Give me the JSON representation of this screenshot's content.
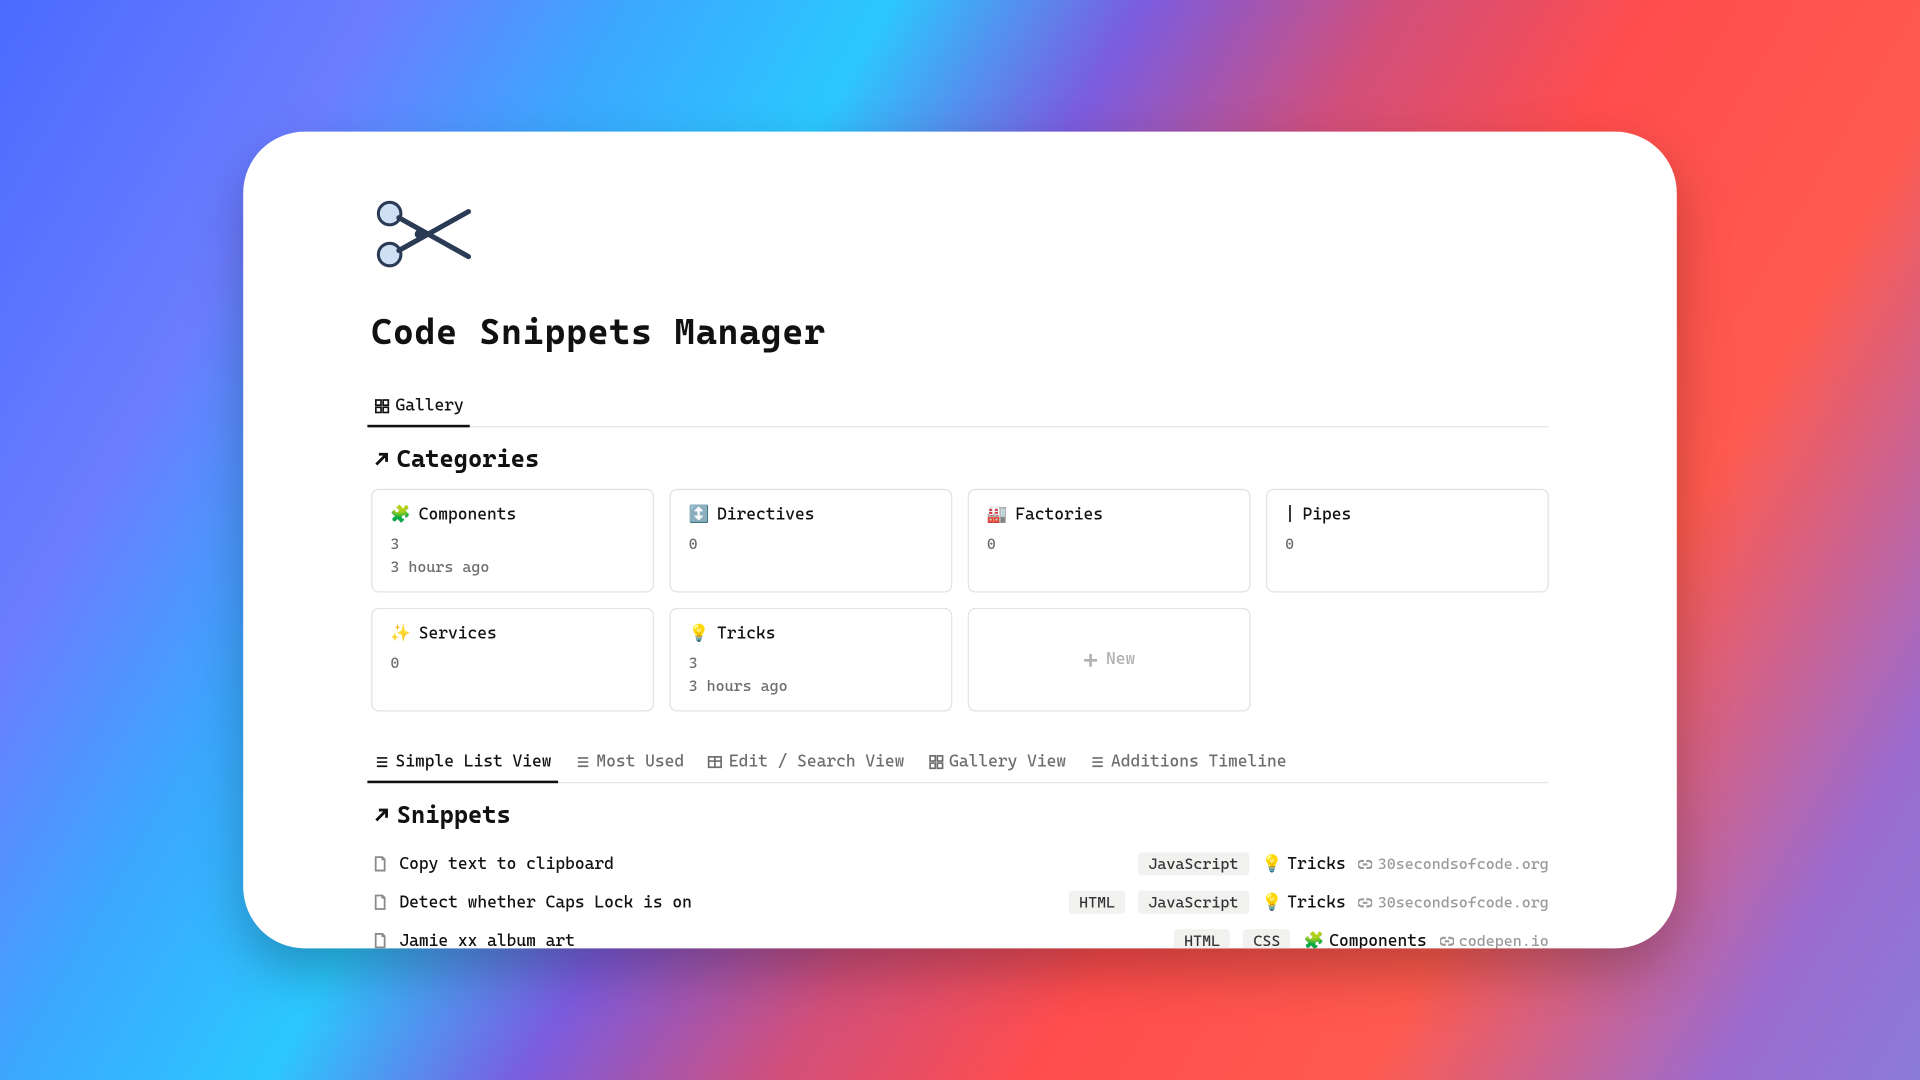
{
  "page": {
    "title": "Code Snippets Manager"
  },
  "views_categories": {
    "tabs": [
      {
        "label": "Gallery",
        "active": true,
        "icon": "gallery"
      }
    ]
  },
  "section_categories": {
    "title": "Categories",
    "items": [
      {
        "emoji": "🧩",
        "name": "Components",
        "count": "3",
        "time": "3 hours ago"
      },
      {
        "emoji": "↕️",
        "name": "Directives",
        "count": "0",
        "time": ""
      },
      {
        "emoji": "🏭",
        "name": "Factories",
        "count": "0",
        "time": ""
      },
      {
        "emoji": "|",
        "name": "Pipes",
        "count": "0",
        "time": ""
      },
      {
        "emoji": "✨",
        "name": "Services",
        "count": "0",
        "time": ""
      },
      {
        "emoji": "💡",
        "name": "Tricks",
        "count": "3",
        "time": "3 hours ago"
      }
    ],
    "new_label": "New"
  },
  "views_snippets": {
    "tabs": [
      {
        "label": "Simple List View",
        "active": true,
        "icon": "list"
      },
      {
        "label": "Most Used",
        "active": false,
        "icon": "list"
      },
      {
        "label": "Edit / Search View",
        "active": false,
        "icon": "table"
      },
      {
        "label": "Gallery View",
        "active": false,
        "icon": "gallery"
      },
      {
        "label": "Additions Timeline",
        "active": false,
        "icon": "list"
      }
    ]
  },
  "section_snippets": {
    "title": "Snippets",
    "rows": [
      {
        "title": "Copy text to clipboard",
        "langs": [
          "JavaScript"
        ],
        "category": {
          "emoji": "💡",
          "name": "Tricks"
        },
        "source": "30secondsofcode.org"
      },
      {
        "title": "Detect whether Caps Lock is on",
        "langs": [
          "HTML",
          "JavaScript"
        ],
        "category": {
          "emoji": "💡",
          "name": "Tricks"
        },
        "source": "30secondsofcode.org"
      },
      {
        "title": "Jamie xx album art",
        "langs": [
          "HTML",
          "CSS"
        ],
        "category": {
          "emoji": "🧩",
          "name": "Components"
        },
        "source": "codepen.io"
      }
    ]
  }
}
